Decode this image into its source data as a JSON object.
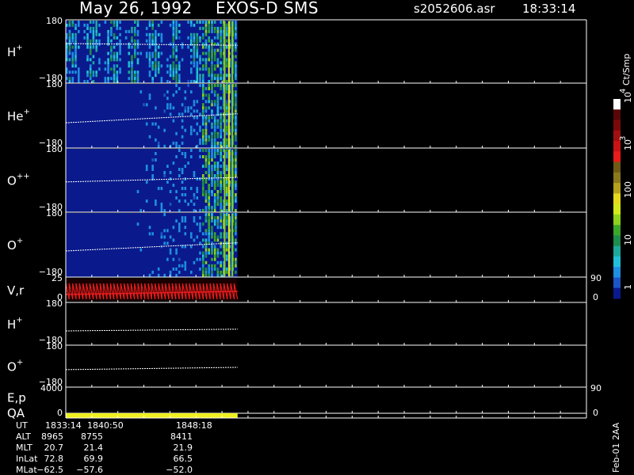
{
  "header": {
    "date": "May 26, 1992",
    "instrument": "EXOS-D SMS",
    "file": "s2052606.asr",
    "time": "18:33:14"
  },
  "colorbar": {
    "unit": "Ct/Smp",
    "labels": [
      "1",
      "10",
      "100",
      "10",
      "10"
    ],
    "exp_labels": [
      "3",
      "4"
    ],
    "colors": [
      "#0a1a8c",
      "#1c55c6",
      "#1f8fe0",
      "#22c0d8",
      "#1ea89a",
      "#1e8c4a",
      "#3aa82a",
      "#8cd21c",
      "#d2e81c",
      "#e6d81c",
      "#b4a01c",
      "#8c781c",
      "#6e5a14",
      "#e81c1c",
      "#c81414",
      "#a01010",
      "#7a0a0a",
      "#5a0606",
      "#ffffff"
    ]
  },
  "chart_data": {
    "type": "heatmap",
    "data_fraction_end": 0.33,
    "panels": [
      {
        "name": "H",
        "sup": "+",
        "ymax": "180",
        "ymin": "-180",
        "kind": "spectrogram",
        "trend": [
          45,
          35
        ]
      },
      {
        "name": "He",
        "sup": "+",
        "ymax": "180",
        "ymin": "-180",
        "kind": "spectrogram",
        "trend": [
          -40,
          10
        ]
      },
      {
        "name": "O",
        "sup": "++",
        "ymax": "180",
        "ymin": "-180",
        "kind": "spectrogram",
        "trend": [
          -10,
          15
        ]
      },
      {
        "name": "O",
        "sup": "+",
        "ymax": "180",
        "ymin": "-180",
        "kind": "spectrogram",
        "trend": [
          -35,
          10
        ]
      },
      {
        "name": "V,r",
        "sup": "",
        "ymax": "25",
        "ymin": "0",
        "kind": "line",
        "rmax": "90",
        "rmin": "0"
      },
      {
        "name": "H",
        "sup": "+",
        "ymax": "180",
        "ymin": "-180",
        "kind": "trace",
        "trend": [
          -60,
          -45
        ]
      },
      {
        "name": "O",
        "sup": "+",
        "ymax": "180",
        "ymin": "-180",
        "kind": "trace",
        "trend": [
          -30,
          -10
        ]
      },
      {
        "name": "E,p",
        "sup": "",
        "ymax": "4000",
        "ymin": "",
        "kind": "empty",
        "rmax": "90",
        "rmin": ""
      },
      {
        "name": "QA",
        "sup": "",
        "ymax": "",
        "ymin": "0",
        "kind": "qa",
        "rmin": "0"
      }
    ],
    "table": {
      "rows": [
        {
          "label": "UT",
          "values": [
            "1833:14",
            "1840:50",
            "1848:18"
          ]
        },
        {
          "label": "ALT",
          "values": [
            "8965",
            "8755",
            "8411"
          ]
        },
        {
          "label": "MLT",
          "values": [
            "20.7",
            "21.4",
            "21.9"
          ]
        },
        {
          "label": "InLat",
          "values": [
            "72.8",
            "69.9",
            "66.5"
          ]
        },
        {
          "label": "MLat",
          "values": [
            "-62.5",
            "-57.6",
            "-52.0"
          ]
        }
      ]
    },
    "footer": "Feb-01 2AA"
  }
}
